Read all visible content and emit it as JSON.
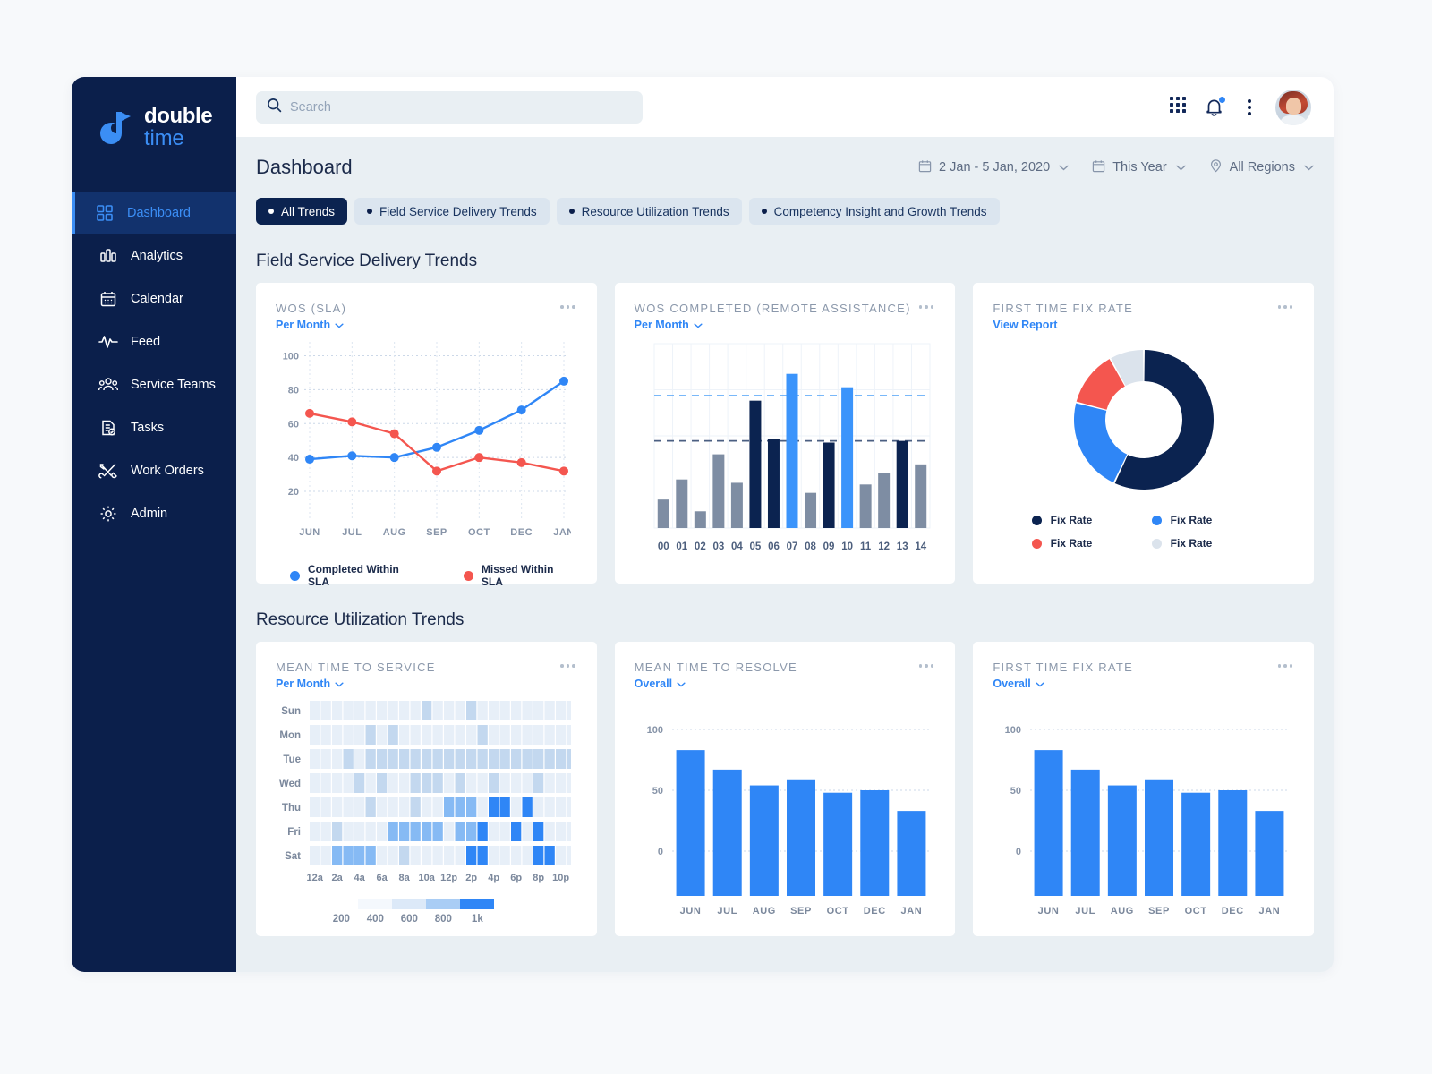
{
  "brand": {
    "name_line1": "double",
    "name_line2": "time",
    "navy": "#0b1f4b",
    "blue": "#2f86f6",
    "red": "#f4564f",
    "light_blue_tint": "#dbe5ef"
  },
  "sidebar": {
    "items": [
      {
        "label": "Dashboard",
        "icon": "grid-icon",
        "active": true
      },
      {
        "label": "Analytics",
        "icon": "bar-chart-icon",
        "active": false
      },
      {
        "label": "Calendar",
        "icon": "calendar-icon",
        "active": false
      },
      {
        "label": "Feed",
        "icon": "pulse-icon",
        "active": false
      },
      {
        "label": "Service Teams",
        "icon": "people-icon",
        "active": false
      },
      {
        "label": "Tasks",
        "icon": "task-list-icon",
        "active": false
      },
      {
        "label": "Work Orders",
        "icon": "tools-icon",
        "active": false
      },
      {
        "label": "Admin",
        "icon": "gear-icon",
        "active": false
      }
    ]
  },
  "topbar": {
    "search_placeholder": "Search",
    "search_value": "",
    "icons": [
      "apps-grid-icon",
      "bell-icon",
      "kebab-menu-icon",
      "avatar"
    ],
    "notification_badge": true
  },
  "header": {
    "title": "Dashboard",
    "filters": [
      {
        "icon": "calendar-icon",
        "label": "2 Jan - 5 Jan, 2020"
      },
      {
        "icon": "calendar-icon",
        "label": "This Year"
      },
      {
        "icon": "location-pin-icon",
        "label": "All Regions"
      }
    ]
  },
  "tabs": [
    {
      "label": "All Trends",
      "active": true
    },
    {
      "label": "Field Service Delivery Trends",
      "active": false
    },
    {
      "label": "Resource Utilization Trends",
      "active": false
    },
    {
      "label": "Competency Insight and Growth Trends",
      "active": false
    }
  ],
  "sections": [
    {
      "title": "Field Service Delivery Trends"
    },
    {
      "title": "Resource Utilization Trends"
    }
  ],
  "cards": {
    "wos_sla": {
      "title": "WOS (SLA)",
      "sub": "Per Month",
      "menu": "more-options"
    },
    "wos_completed": {
      "title": "WOs COMPLETED (REMOTE ASSISTANCE)",
      "sub": "Per Month",
      "menu": "more-options"
    },
    "ftfr_donut": {
      "title": "FIRST TIME FIX RATE",
      "sub": "View Report",
      "menu": "more-options"
    },
    "mean_time_service": {
      "title": "MEAN TIME TO SERVICE",
      "sub": "Per Month",
      "menu": "more-options"
    },
    "mean_time_resolve": {
      "title": "MEAN TIME TO RESOLVE",
      "sub": "Overall",
      "menu": "more-options"
    },
    "ftfr_bar": {
      "title": "FIRST TIME FIX RATE",
      "sub": "Overall",
      "menu": "more-options"
    }
  },
  "chart_data": [
    {
      "id": "wos_sla",
      "type": "line",
      "title": "WOS (SLA)",
      "xlabel": "",
      "ylabel": "",
      "categories": [
        "JUN",
        "JUL",
        "AUG",
        "SEP",
        "OCT",
        "DEC",
        "JAN"
      ],
      "yticks": [
        20,
        40,
        60,
        80,
        100
      ],
      "ylim": [
        10,
        105
      ],
      "grid": true,
      "legend_position": "bottom",
      "series": [
        {
          "name": "Completed Within SLA",
          "color": "#2f86f6",
          "values": [
            39,
            41,
            40,
            46,
            56,
            68,
            85
          ]
        },
        {
          "name": "Missed Within SLA",
          "color": "#f4564f",
          "values": [
            66,
            61,
            54,
            32,
            40,
            37,
            32
          ]
        }
      ]
    },
    {
      "id": "wos_completed",
      "type": "bar",
      "title": "WOs COMPLETED (REMOTE ASSISTANCE)",
      "categories": [
        "00",
        "01",
        "02",
        "03",
        "04",
        "05",
        "06",
        "07",
        "08",
        "09",
        "10",
        "11",
        "12",
        "13",
        "14"
      ],
      "values": [
        17,
        29,
        10,
        44,
        27,
        76,
        53,
        92,
        21,
        51,
        84,
        26,
        33,
        52,
        38
      ],
      "ylim": [
        0,
        110
      ],
      "grid": true,
      "bar_colors": [
        "#7e8da3",
        "#7e8da3",
        "#7e8da3",
        "#7e8da3",
        "#7e8da3",
        "#0b2350",
        "#0b2350",
        "#3b94fb",
        "#7e8da3",
        "#0b2350",
        "#3b94fb",
        "#7e8da3",
        "#7e8da3",
        "#0b2350",
        "#7e8da3"
      ],
      "reference_lines": [
        {
          "value": 79,
          "color": "#4da0f7",
          "style": "dashed"
        },
        {
          "value": 52,
          "color": "#4b5f82",
          "style": "dashed"
        }
      ]
    },
    {
      "id": "ftfr_donut",
      "type": "pie",
      "title": "FIRST TIME FIX RATE",
      "labels": [
        "Fix Rate",
        "Fix Rate",
        "Fix Rate",
        "Fix Rate"
      ],
      "values": [
        57,
        22,
        13,
        8
      ],
      "colors": [
        "#0b2350",
        "#2f86f6",
        "#f4564f",
        "#dbe3ec"
      ],
      "legend_position": "bottom",
      "donut": true
    },
    {
      "id": "mean_time_service",
      "type": "heatmap",
      "title": "MEAN TIME TO SERVICE",
      "yticks": [
        "Sun",
        "Mon",
        "Tue",
        "Wed",
        "Thu",
        "Fri",
        "Sat"
      ],
      "xticks": [
        "12a",
        "",
        "2a",
        "",
        "4a",
        "",
        "6a",
        "",
        "8a",
        "",
        "10a",
        "",
        "12p",
        "",
        "2p",
        "",
        "4p",
        "",
        "6p",
        "",
        "8p",
        "",
        "10p",
        ""
      ],
      "legend_ticks": [
        "200",
        "400",
        "600",
        "800",
        "1k"
      ],
      "legend_colors": [
        "#f4f8fd",
        "#dce9f8",
        "#a9cdf5",
        "#2f86f6"
      ],
      "scale_max": 1000,
      "values": [
        [
          1,
          1,
          1,
          1,
          1,
          1,
          1,
          1,
          1,
          1,
          2,
          1,
          1,
          1,
          2,
          1,
          1,
          1,
          1,
          1,
          1,
          1,
          1,
          1
        ],
        [
          1,
          1,
          1,
          1,
          1,
          2,
          1,
          2,
          1,
          1,
          1,
          1,
          1,
          1,
          1,
          2,
          1,
          1,
          1,
          1,
          1,
          1,
          1,
          1
        ],
        [
          1,
          1,
          1,
          2,
          1,
          2,
          2,
          2,
          2,
          2,
          2,
          2,
          2,
          2,
          2,
          2,
          2,
          2,
          2,
          2,
          2,
          2,
          2,
          2
        ],
        [
          1,
          1,
          1,
          1,
          2,
          1,
          2,
          1,
          1,
          2,
          2,
          2,
          1,
          2,
          1,
          1,
          2,
          1,
          1,
          1,
          2,
          1,
          1,
          1
        ],
        [
          1,
          1,
          1,
          1,
          1,
          2,
          1,
          1,
          1,
          2,
          1,
          1,
          3,
          3,
          3,
          1,
          4,
          4,
          1,
          4,
          1,
          1,
          1,
          1
        ],
        [
          1,
          1,
          2,
          1,
          1,
          1,
          1,
          3,
          3,
          3,
          3,
          3,
          1,
          3,
          3,
          4,
          1,
          1,
          4,
          1,
          4,
          1,
          1,
          1
        ],
        [
          1,
          1,
          3,
          3,
          3,
          3,
          1,
          1,
          2,
          1,
          1,
          1,
          1,
          1,
          4,
          4,
          1,
          1,
          1,
          1,
          4,
          4,
          1,
          1
        ]
      ]
    },
    {
      "id": "mean_time_resolve",
      "type": "bar",
      "title": "MEAN TIME TO RESOLVE",
      "categories": [
        "JUN",
        "JUL",
        "AUG",
        "SEP",
        "OCT",
        "DEC",
        "JAN"
      ],
      "values": [
        83,
        67,
        54,
        59,
        48,
        50,
        33
      ],
      "yticks": [
        0,
        50,
        100
      ],
      "ylim": [
        -22,
        100
      ],
      "grid": true,
      "bar_color": "#2f86f6"
    },
    {
      "id": "ftfr_bar",
      "type": "bar",
      "title": "FIRST TIME FIX RATE",
      "categories": [
        "JUN",
        "JUL",
        "AUG",
        "SEP",
        "OCT",
        "DEC",
        "JAN"
      ],
      "values": [
        83,
        67,
        54,
        59,
        48,
        50,
        33
      ],
      "yticks": [
        0,
        50,
        100
      ],
      "ylim": [
        -22,
        100
      ],
      "grid": true,
      "bar_color": "#2f86f6"
    }
  ]
}
